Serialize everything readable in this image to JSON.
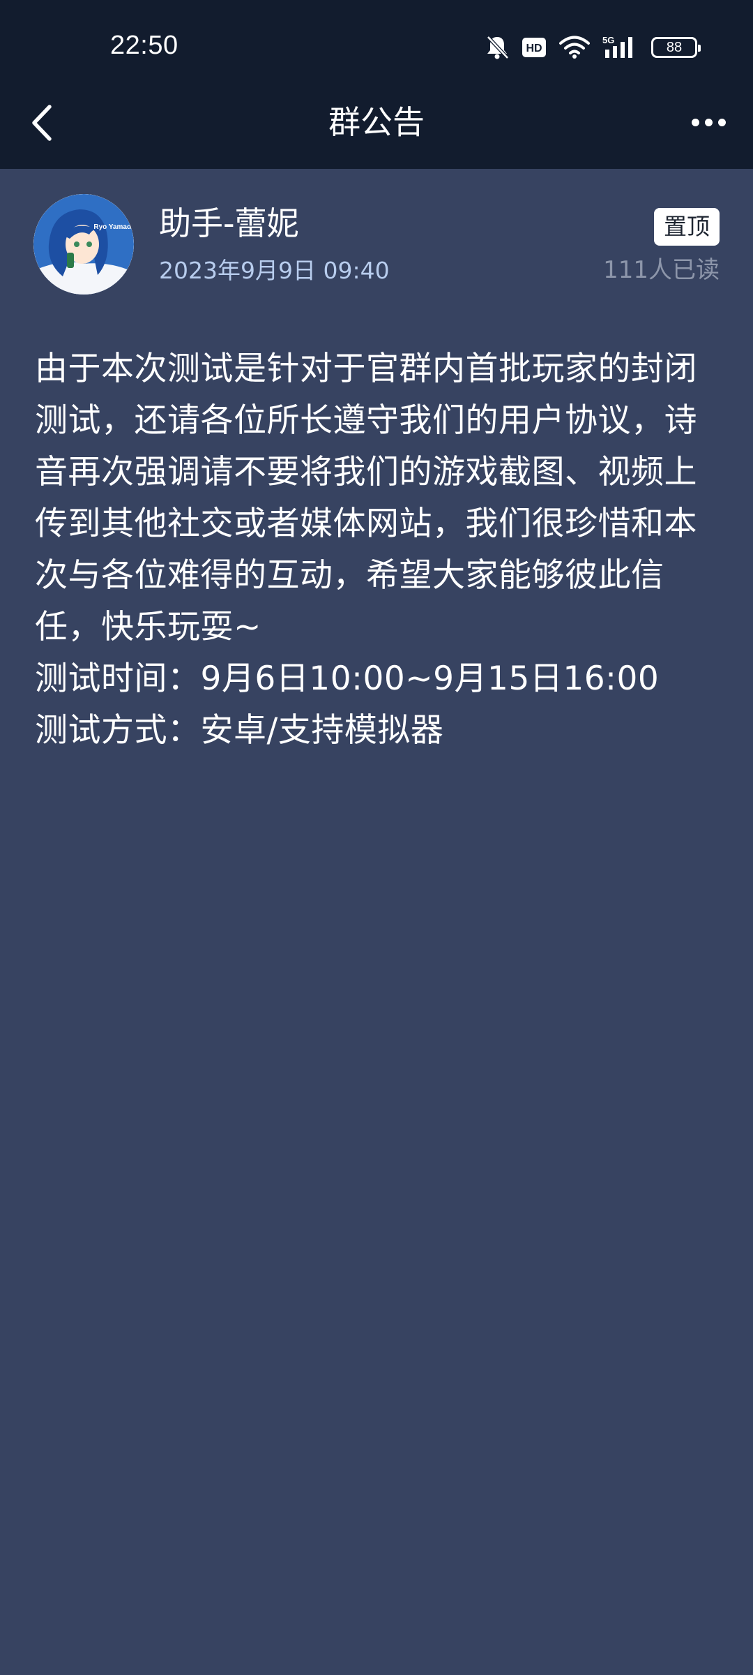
{
  "status_bar": {
    "time": "22:50",
    "icons": [
      "bell-off-icon",
      "hd-icon",
      "wifi-icon",
      "signal-5g-icon",
      "battery-icon"
    ],
    "hd_label": "HD",
    "network_label": "5G",
    "battery": "88"
  },
  "header": {
    "title": "群公告",
    "back_icon": "chevron-left-icon",
    "more_icon": "more-horizontal-icon"
  },
  "post": {
    "author": "助手-蕾妮",
    "date": "2023年9月9日 09:40",
    "pin_label": "置顶",
    "read_count": "111人已读",
    "avatar_text": "Ryo Yamada",
    "body": "由于本次测试是针对于官群内首批玩家的封闭测试，还请各位所长遵守我们的用户协议，诗音再次强调请不要将我们的游戏截图、视频上传到其他社交或者媒体网站，我们很珍惜和本次与各位难得的互动，希望大家能够彼此信任，快乐玩耍~",
    "test_time": "测试时间：9月6日10:00~9月15日16:00",
    "test_method": "测试方式：安卓/支持模拟器"
  },
  "colors": {
    "topbar_bg": "#121c2e",
    "page_bg": "#374361",
    "date_text": "#b8cdee",
    "read_count_text": "#8d96aa"
  }
}
